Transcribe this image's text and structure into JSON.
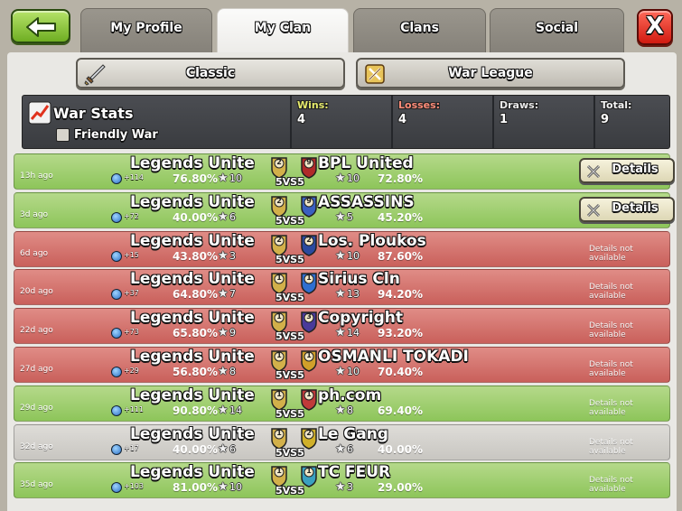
{
  "tabs": {
    "my_profile": "My Profile",
    "my_clan": "My Clan",
    "clans": "Clans",
    "social": "Social"
  },
  "close_label": "X",
  "modes": {
    "classic": "Classic",
    "war_league": "War League"
  },
  "war_stats": {
    "title": "War Stats",
    "friendly_war_label": "Friendly War",
    "wins_label": "Wins:",
    "wins": "4",
    "losses_label": "Losses:",
    "losses": "4",
    "draws_label": "Draws:",
    "draws": "1",
    "total_label": "Total:",
    "total": "9"
  },
  "vs_label": "5VS5",
  "details_label": "Details",
  "not_available_label": "Details not available",
  "wars": [
    {
      "ago": "13h ago",
      "result": "win",
      "clan": "Legends Unite",
      "trophies": "+114",
      "clan_pct": "76.80%",
      "clan_stars": "10",
      "opponent": "BPL United",
      "opp_stars": "10",
      "opp_pct": "72.80%",
      "details": true,
      "left_badge": "2",
      "right_badge": "9"
    },
    {
      "ago": "3d ago",
      "result": "win",
      "clan": "Legends Unite",
      "trophies": "+72",
      "clan_pct": "40.00%",
      "clan_stars": "6",
      "opponent": "ASSASSINS",
      "opp_stars": "5",
      "opp_pct": "45.20%",
      "details": true,
      "left_badge": "2",
      "right_badge": "9"
    },
    {
      "ago": "6d ago",
      "result": "loss",
      "clan": "Legends Unite",
      "trophies": "+15",
      "clan_pct": "43.80%",
      "clan_stars": "3",
      "opponent": "Los. Ploukos",
      "opp_stars": "10",
      "opp_pct": "87.60%",
      "details": false,
      "left_badge": "2",
      "right_badge": "2"
    },
    {
      "ago": "20d ago",
      "result": "loss",
      "clan": "Legends Unite",
      "trophies": "+37",
      "clan_pct": "64.80%",
      "clan_stars": "7",
      "opponent": "Sirius Cln",
      "opp_stars": "13",
      "opp_pct": "94.20%",
      "details": false,
      "left_badge": "1",
      "right_badge": "1"
    },
    {
      "ago": "22d ago",
      "result": "loss",
      "clan": "Legends Unite",
      "trophies": "+73",
      "clan_pct": "65.80%",
      "clan_stars": "9",
      "opponent": "Copyright",
      "opp_stars": "14",
      "opp_pct": "93.20%",
      "details": false,
      "left_badge": "1",
      "right_badge": "3"
    },
    {
      "ago": "27d ago",
      "result": "loss",
      "clan": "Legends Unite",
      "trophies": "+29",
      "clan_pct": "56.80%",
      "clan_stars": "8",
      "opponent": "OSMANLI TOKADI",
      "opp_stars": "10",
      "opp_pct": "70.40%",
      "details": false,
      "left_badge": "1",
      "right_badge": "1"
    },
    {
      "ago": "29d ago",
      "result": "win",
      "clan": "Legends Unite",
      "trophies": "+111",
      "clan_pct": "90.80%",
      "clan_stars": "14",
      "opponent": "ph.com",
      "opp_stars": "8",
      "opp_pct": "69.40%",
      "details": false,
      "left_badge": "1",
      "right_badge": "1"
    },
    {
      "ago": "32d ago",
      "result": "draw",
      "clan": "Legends Unite",
      "trophies": "+17",
      "clan_pct": "40.00%",
      "clan_stars": "6",
      "opponent": "Le Gang",
      "opp_stars": "6",
      "opp_pct": "40.00%",
      "details": false,
      "left_badge": "1",
      "right_badge": "2"
    },
    {
      "ago": "35d ago",
      "result": "win",
      "clan": "Legends Unite",
      "trophies": "+103",
      "clan_pct": "81.00%",
      "clan_stars": "10",
      "opponent": "TC FEUR",
      "opp_stars": "3",
      "opp_pct": "29.00%",
      "details": false,
      "left_badge": "1",
      "right_badge": "1"
    }
  ],
  "colors": {
    "win_row": "#9ccd6e",
    "loss_row": "#d4736e",
    "draw_row": "#d3d1cc",
    "back_button": "#8fcb3c",
    "close_button": "#e2281c"
  }
}
